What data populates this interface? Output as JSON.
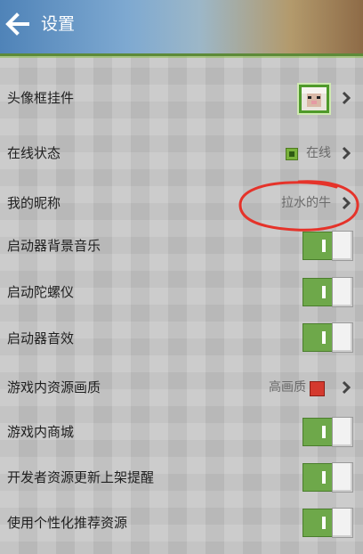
{
  "header": {
    "title": "设置",
    "back_icon": "back-arrow-icon"
  },
  "rows": [
    {
      "label": "头像框挂件",
      "value": "",
      "control": "chevron"
    },
    {
      "label": "在线状态",
      "value": "在线",
      "control": "chevron"
    },
    {
      "label": "我的昵称",
      "value": "拉水的牛",
      "control": "chevron"
    },
    {
      "label": "启动器背景音乐",
      "control": "toggle",
      "on": true
    },
    {
      "label": "启动陀螺仪",
      "control": "toggle",
      "on": true
    },
    {
      "label": "启动器音效",
      "control": "toggle",
      "on": true
    },
    {
      "label": "游戏内资源画质",
      "value": "高画质",
      "control": "chevron"
    },
    {
      "label": "游戏内商城",
      "control": "toggle",
      "on": true
    },
    {
      "label": "开发者资源更新上架提醒",
      "control": "toggle",
      "on": true
    },
    {
      "label": "使用个性化推荐资源",
      "control": "toggle",
      "on": true
    }
  ],
  "colors": {
    "toggle_on": "#6ea84a",
    "status_online": "#79b23b",
    "quality_marker": "#d43a2f",
    "annotation": "#e5332a"
  }
}
